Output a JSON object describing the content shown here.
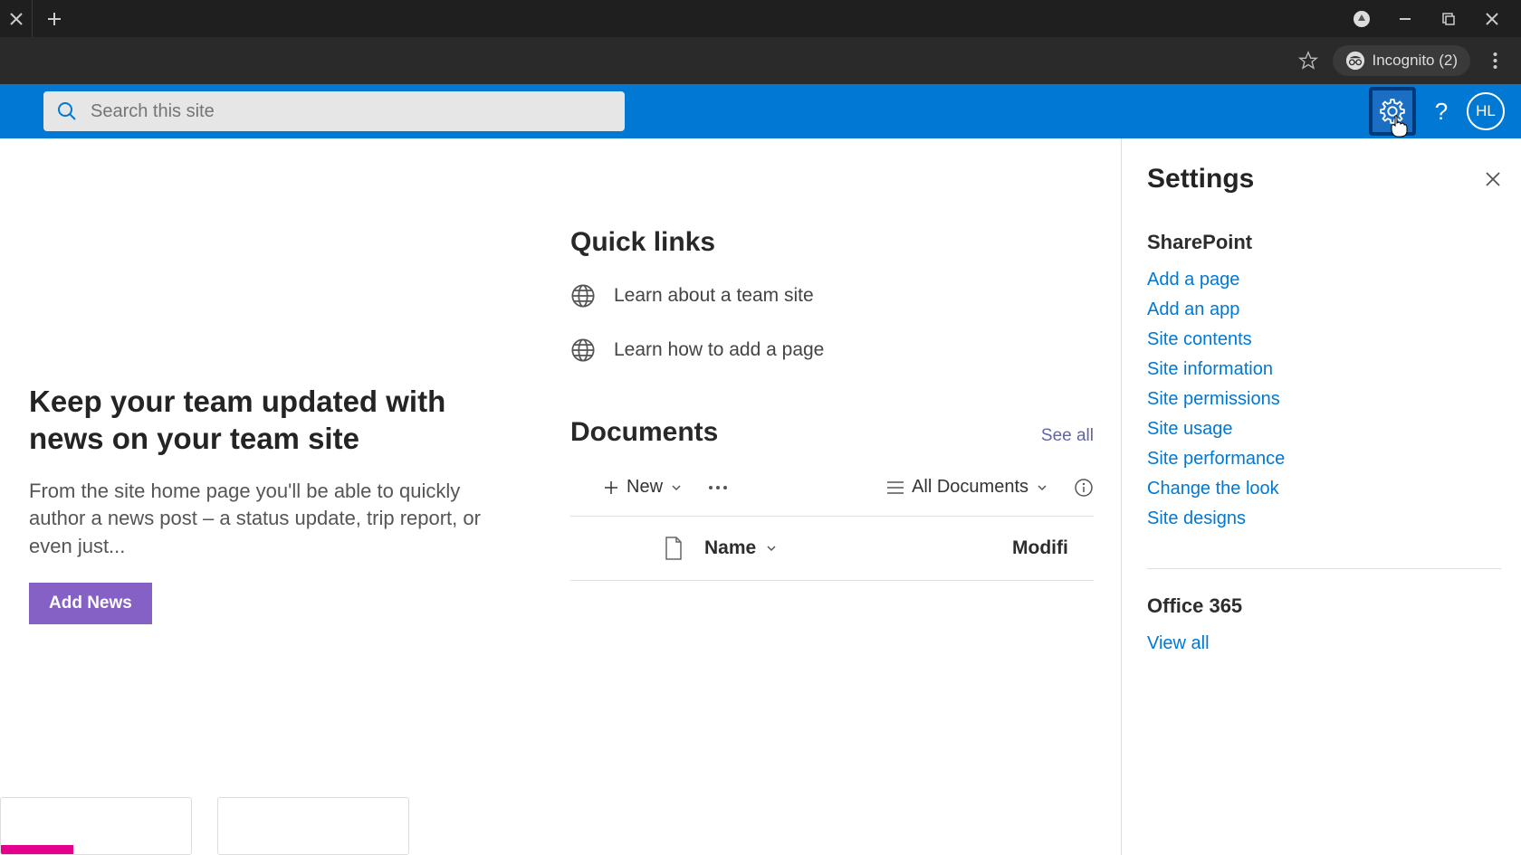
{
  "browser": {
    "incognito_label": "Incognito (2)"
  },
  "suite": {
    "search_placeholder": "Search this site",
    "avatar_initials": "HL"
  },
  "news": {
    "title": "Keep your team updated with news on your team site",
    "desc": "From the site home page you'll be able to quickly author a news post – a status update, trip report, or even just...",
    "button": "Add News"
  },
  "quicklinks": {
    "title": "Quick links",
    "items": [
      {
        "label": "Learn about a team site"
      },
      {
        "label": "Learn how to add a page"
      }
    ]
  },
  "documents": {
    "title": "Documents",
    "see_all": "See all",
    "new_label": "New",
    "view_label": "All Documents",
    "col_name": "Name",
    "col_modified": "Modifi"
  },
  "settings": {
    "title": "Settings",
    "group1_title": "SharePoint",
    "group1_links": [
      "Add a page",
      "Add an app",
      "Site contents",
      "Site information",
      "Site permissions",
      "Site usage",
      "Site performance",
      "Change the look",
      "Site designs"
    ],
    "group2_title": "Office 365",
    "group2_links": [
      "View all"
    ]
  }
}
